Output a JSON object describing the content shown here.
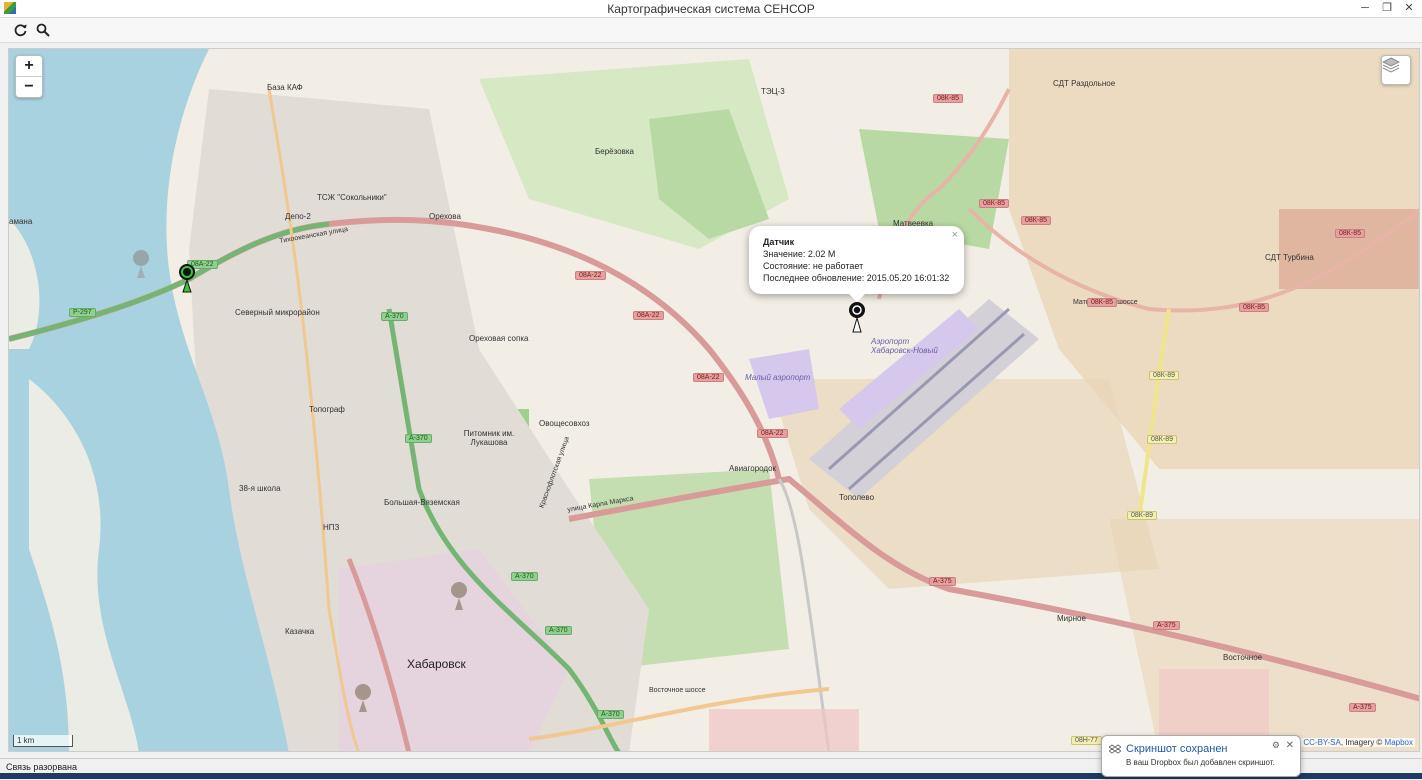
{
  "window": {
    "title": "Картографическая система СЕНСОР",
    "minimize": "─",
    "restore": "❐",
    "close": "✕"
  },
  "toolbar": {
    "refresh_icon": "refresh-icon",
    "search_icon": "search-icon"
  },
  "map": {
    "zoom_in": "+",
    "zoom_out": "−",
    "scale": "1 km",
    "attribution": {
      "osm": "CC-BY-SA",
      "imagery": ", Imagery © ",
      "mapbox": "Mapbox"
    },
    "popup": {
      "title": "Датчик",
      "value": "Значение: 2.02 М",
      "state": "Состояние: не работает",
      "updated": "Последнее обновление: 2015.05.20 16:01:32",
      "close": "×"
    },
    "places": [
      {
        "id": "baza-kaf",
        "text": "База КАФ"
      },
      {
        "id": "depo-2",
        "text": "Депо-2"
      },
      {
        "id": "sokolniki",
        "text": "ТСЖ \"Сокольники\""
      },
      {
        "id": "severny",
        "text": "Северный микрорайон"
      },
      {
        "id": "topograf",
        "text": "Топограф"
      },
      {
        "id": "orekhovaya",
        "text": "Ореховая сопка"
      },
      {
        "id": "pitomnik",
        "text": "Питомник им. Лукашова"
      },
      {
        "id": "ovoshchesovkhoz",
        "text": "Овощесовхоз"
      },
      {
        "id": "berezovka",
        "text": "Берёзовка"
      },
      {
        "id": "aviagorodok",
        "text": "Авиагородок"
      },
      {
        "id": "topolevo",
        "text": "Тополево"
      },
      {
        "id": "bolshaya-vyazemskaya",
        "text": "Большая-Вяземская"
      },
      {
        "id": "shkola38",
        "text": "38-я школа"
      },
      {
        "id": "npz",
        "text": "НПЗ"
      },
      {
        "id": "kazachka",
        "text": "Казачка"
      },
      {
        "id": "khabarovsk",
        "text": "Хабаровск"
      },
      {
        "id": "mirnoe",
        "text": "Мирное"
      },
      {
        "id": "vostochnoe",
        "text": "Восточное"
      },
      {
        "id": "razdolnoe",
        "text": "СДТ Раздольное"
      },
      {
        "id": "turbina",
        "text": "СДТ Турбина"
      },
      {
        "id": "matveevka",
        "text": "Матвеевка"
      },
      {
        "id": "airport",
        "text": "Аэропорт Хабаровск-Новый"
      },
      {
        "id": "maly-airport",
        "text": "Малый аэропорт"
      },
      {
        "id": "tec3",
        "text": "ТЭЦ-3"
      },
      {
        "id": "amanza",
        "text": "амана"
      },
      {
        "id": "orekhova",
        "text": "Орехова"
      }
    ],
    "shields": [
      {
        "id": "r297",
        "text": "Р-297",
        "kind": "green"
      },
      {
        "id": "08a22-west",
        "text": "08А-22",
        "kind": "green"
      },
      {
        "id": "08a22-1",
        "text": "08А-22",
        "kind": "red"
      },
      {
        "id": "08a22-2",
        "text": "08А-22",
        "kind": "red"
      },
      {
        "id": "08a22-3",
        "text": "08А-22",
        "kind": "red"
      },
      {
        "id": "08a22-4",
        "text": "08А-22",
        "kind": "red"
      },
      {
        "id": "a370-1",
        "text": "А-370",
        "kind": "green"
      },
      {
        "id": "a370-2",
        "text": "А-370",
        "kind": "green"
      },
      {
        "id": "a370-3",
        "text": "А-370",
        "kind": "green"
      },
      {
        "id": "a370-4",
        "text": "А-370",
        "kind": "green"
      },
      {
        "id": "a370-5",
        "text": "А-370",
        "kind": "green"
      },
      {
        "id": "08k85-1",
        "text": "08К-85",
        "kind": "red"
      },
      {
        "id": "08k85-2",
        "text": "08К-85",
        "kind": "red"
      },
      {
        "id": "08k85-3",
        "text": "08К-85",
        "kind": "red"
      },
      {
        "id": "08k85-4",
        "text": "08К-85",
        "kind": "red"
      },
      {
        "id": "08k85-5",
        "text": "08К-85",
        "kind": "red"
      },
      {
        "id": "08k85-6",
        "text": "08К-85",
        "kind": "red"
      },
      {
        "id": "08k89-1",
        "text": "08К-89",
        "kind": "yellow"
      },
      {
        "id": "08k89-2",
        "text": "08К-89",
        "kind": "yellow"
      },
      {
        "id": "08k89-3",
        "text": "08К-89",
        "kind": "yellow"
      },
      {
        "id": "a375-1",
        "text": "А-375",
        "kind": "red"
      },
      {
        "id": "a375-2",
        "text": "А-375",
        "kind": "red"
      },
      {
        "id": "a375-3",
        "text": "А-375",
        "kind": "red"
      },
      {
        "id": "08n77",
        "text": "08Н-77",
        "kind": "yellow"
      }
    ],
    "streets": [
      {
        "id": "vostochnoe-shosse",
        "text": "Восточное шоссе"
      },
      {
        "id": "kul-marksa",
        "text": "улица Карла Маркса"
      },
      {
        "id": "matveevskoe",
        "text": "Матвеевское шоссе"
      },
      {
        "id": "tikhookeanskaya",
        "text": "Тихоокеанская улица"
      },
      {
        "id": "krasnoflotskaya",
        "text": "Краснофлотская улица"
      }
    ],
    "sensors": [
      {
        "id": "sensor-active",
        "status": "ok"
      },
      {
        "id": "sensor-west",
        "status": "inactive"
      },
      {
        "id": "sensor-airport",
        "status": "broken"
      },
      {
        "id": "sensor-south",
        "status": "inactive"
      },
      {
        "id": "sensor-city",
        "status": "inactive"
      }
    ]
  },
  "status": {
    "text": "Связь разорвана"
  },
  "toast": {
    "title": "Скриншот сохранен",
    "message": "В ваш Dropbox был добавлен скриншот.",
    "close": "✕",
    "pin": "🔧"
  },
  "colors": {
    "river": "#a9d2e0",
    "road_red": "#d99a9a",
    "road_green": "#73b573",
    "land": "#f2eee6",
    "forest": "#b9d9a4",
    "farmland": "#ead6b8"
  }
}
